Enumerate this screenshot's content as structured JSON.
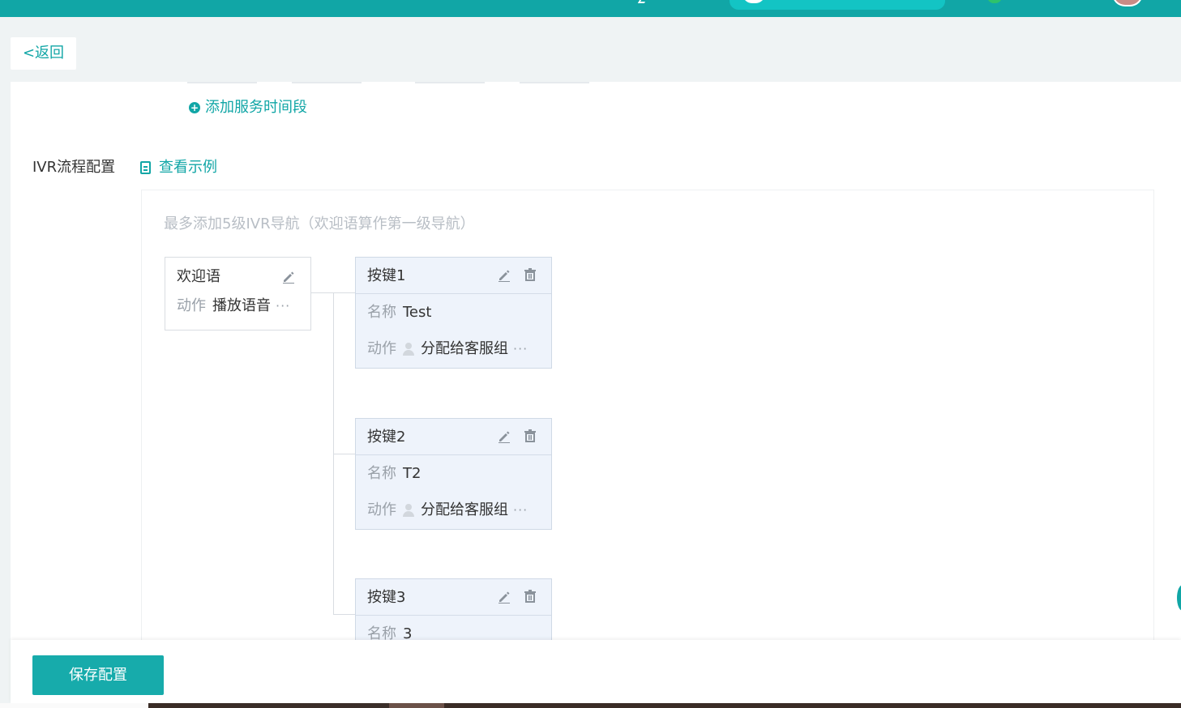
{
  "colors": {
    "accent": "#11a6a6",
    "save_button": "#17abab",
    "node_bg": "#eef3fb",
    "muted_text": "#9aa1a9",
    "hint_text": "#b8bec5"
  },
  "nav": {
    "back_label": "<返回"
  },
  "service_time": {
    "add_label": "添加服务时间段"
  },
  "ivr": {
    "section_label": "IVR流程配置",
    "view_example_label": "查看示例",
    "hint": "最多添加5级IVR导航（欢迎语算作第一级导航）",
    "welcome": {
      "title": "欢迎语",
      "action_label": "动作",
      "action_value": "播放语音",
      "more": "···"
    },
    "keys": [
      {
        "title": "按键1",
        "name_label": "名称",
        "name_value": "Test",
        "action_label": "动作",
        "action_value": "分配给客服组",
        "more": "···"
      },
      {
        "title": "按键2",
        "name_label": "名称",
        "name_value": "T2",
        "action_label": "动作",
        "action_value": "分配给客服组",
        "more": "···"
      },
      {
        "title": "按键3",
        "name_label": "名称",
        "name_value": "3"
      }
    ]
  },
  "footer": {
    "save_label": "保存配置"
  }
}
